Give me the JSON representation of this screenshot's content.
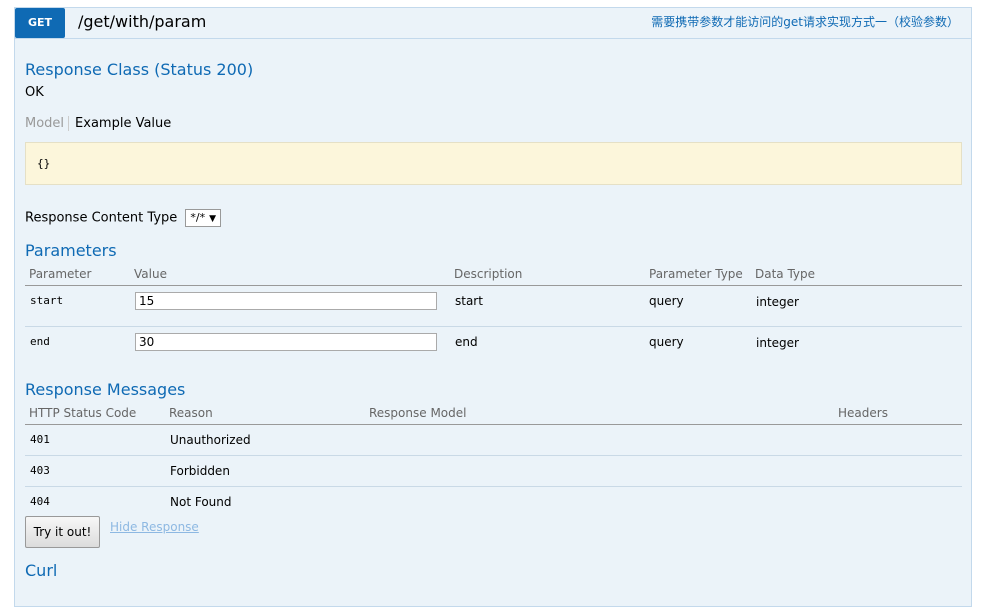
{
  "operation": {
    "method": "GET",
    "path": "/get/with/param",
    "summary": "需要携带参数才能访问的get请求实现方式一（校验参数）"
  },
  "response_class": {
    "title": "Response Class (Status 200)",
    "status_text": "OK",
    "tabs": [
      "Model",
      "Example Value"
    ],
    "example": "{}"
  },
  "response_content_type": {
    "label": "Response Content Type",
    "selected": "*/*"
  },
  "parameters": {
    "title": "Parameters",
    "headers": [
      "Parameter",
      "Value",
      "Description",
      "Parameter Type",
      "Data Type"
    ],
    "rows": [
      {
        "name": "start",
        "value": "15",
        "description": "start",
        "param_type": "query",
        "data_type": "integer"
      },
      {
        "name": "end",
        "value": "30",
        "description": "end",
        "param_type": "query",
        "data_type": "integer"
      }
    ]
  },
  "response_messages": {
    "title": "Response Messages",
    "headers": [
      "HTTP Status Code",
      "Reason",
      "Response Model",
      "Headers"
    ],
    "rows": [
      {
        "code": "401",
        "reason": "Unauthorized"
      },
      {
        "code": "403",
        "reason": "Forbidden"
      },
      {
        "code": "404",
        "reason": "Not Found"
      }
    ]
  },
  "actions": {
    "try_label": "Try it out!",
    "hide_label": "Hide Response"
  },
  "curl": {
    "title": "Curl"
  },
  "colors": {
    "accent": "#0f6ab4",
    "panel_bg": "#ebf3f9",
    "snippet_bg": "#fcf6db"
  }
}
